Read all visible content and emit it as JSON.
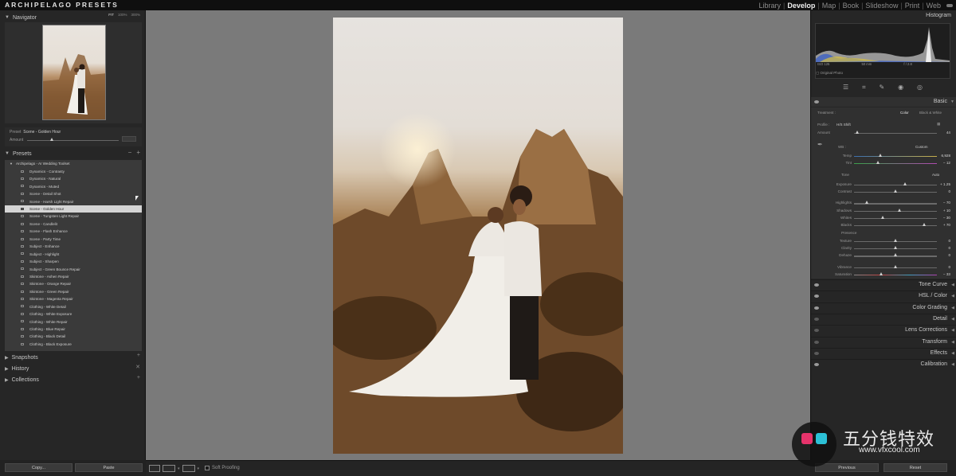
{
  "brand": "ARCHIPELAGO PRESETS",
  "modules": [
    "Library",
    "Develop",
    "Map",
    "Book",
    "Slideshow",
    "Print",
    "Web"
  ],
  "active_module": "Develop",
  "navigator": {
    "title": "Navigator",
    "zoom": [
      "FIT",
      "100%",
      "300%"
    ]
  },
  "preset_info": {
    "preset_label": "Preset",
    "preset_value": "Scene - Golden Hour",
    "amount_label": "Amount"
  },
  "presets": {
    "title": "Presets",
    "group": "Archipelago - AI Wedding Toolset",
    "items": [
      "Dynamics - Contrasty",
      "Dynamics - Natural",
      "Dynamics - Muted",
      "Scene - Detail Shot",
      "Scene - Harsh Light Repair",
      "Scene - Golden Hour",
      "Scene - Tungsten Light Repair",
      "Scene - Candlelit",
      "Scene - Flash Enhance",
      "Scene - Party Time",
      "Subject - Enhance",
      "Subject - Highlight",
      "Subject - Sharpen",
      "Subject - Green Bounce Repair",
      "Skintone - Ashen Repair",
      "Skintone - Orange Repair",
      "Skintone - Green Repair",
      "Skintone - Magenta Repair",
      "Clothing - White Detail",
      "Clothing - White Exposure",
      "Clothing - White Repair",
      "Clothing - Blue Repair",
      "Clothing - Black Detail",
      "Clothing - Black Exposure"
    ],
    "selected_index": 5
  },
  "left_sections": [
    "Snapshots",
    "History",
    "Collections"
  ],
  "histogram": {
    "title": "Histogram",
    "iso": "ISO 125",
    "focal": "50 mm",
    "aperture": "f / 2.8",
    "original_photo": "Original Photo"
  },
  "basic": {
    "title": "Basic",
    "treatment_label": "Treatment :",
    "treatment_color": "Color",
    "treatment_bw": "Black & White",
    "profile_label": "Profile :",
    "profile_value": "H/S Shift",
    "amount_label": "Amount",
    "amount_value": "44",
    "wb_label": "WB :",
    "wb_value": "Custom",
    "temp_label": "Temp",
    "temp_value": "6,928",
    "tint_label": "Tint",
    "tint_value": "− 12",
    "tone_label": "Tone",
    "tone_auto": "Auto",
    "sliders_tone": [
      {
        "label": "Exposure",
        "value": "+ 1.25",
        "pos": 0.62
      },
      {
        "label": "Contrast",
        "value": "0",
        "pos": 0.5
      }
    ],
    "sliders_hl": [
      {
        "label": "Highlights",
        "value": "− 70",
        "pos": 0.15
      },
      {
        "label": "Shadows",
        "value": "+ 10",
        "pos": 0.55
      },
      {
        "label": "Whites",
        "value": "− 30",
        "pos": 0.35
      },
      {
        "label": "Blacks",
        "value": "+ 70",
        "pos": 0.85
      }
    ],
    "presence_label": "Presence",
    "sliders_presence": [
      {
        "label": "Texture",
        "value": "0",
        "pos": 0.5
      },
      {
        "label": "Clarity",
        "value": "0",
        "pos": 0.5
      },
      {
        "label": "Dehaze",
        "value": "0",
        "pos": 0.5
      }
    ],
    "sliders_vib": [
      {
        "label": "Vibrance",
        "value": "0",
        "pos": 0.5
      },
      {
        "label": "Saturation",
        "value": "− 33",
        "pos": 0.33
      }
    ]
  },
  "right_sections": [
    "Tone Curve",
    "HSL / Color",
    "Color Grading",
    "Detail",
    "Lens Corrections",
    "Transform",
    "Effects",
    "Calibration"
  ],
  "bottom": {
    "copy": "Copy...",
    "paste": "Paste",
    "soft_proofing": "Soft Proofing",
    "previous": "Previous",
    "reset": "Reset"
  },
  "watermark": {
    "text": "五分钱特效",
    "url": "www.vfxcool.com"
  }
}
